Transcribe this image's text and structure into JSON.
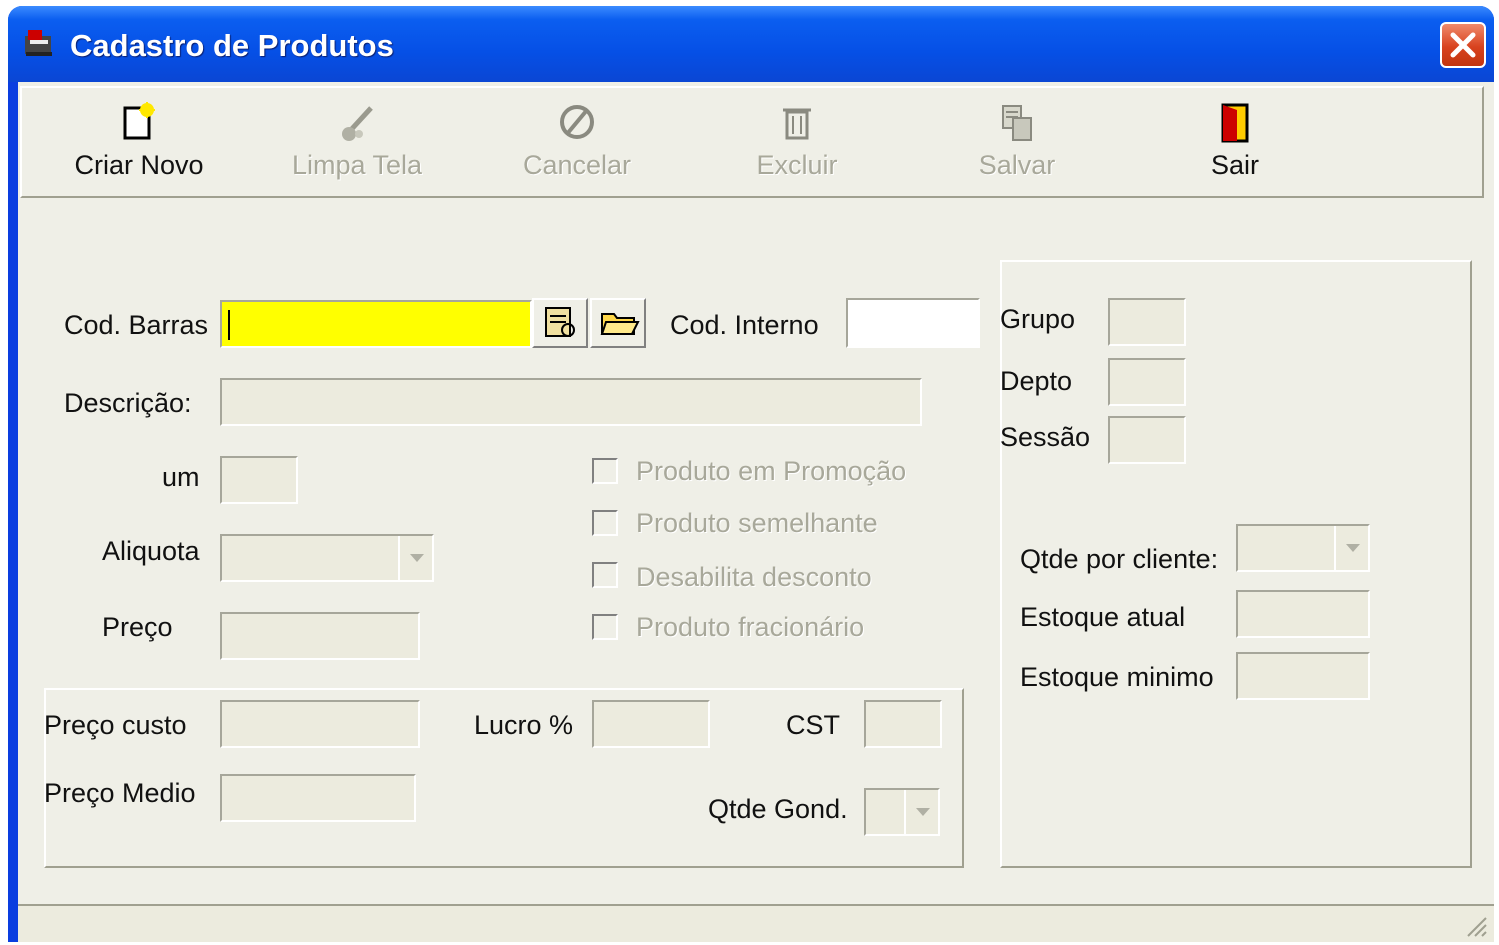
{
  "window": {
    "title": "Cadastro de Produtos"
  },
  "toolbar": {
    "criar_novo": "Criar Novo",
    "limpa_tela": "Limpa Tela",
    "cancelar": "Cancelar",
    "excluir": "Excluir",
    "salvar": "Salvar",
    "sair": "Sair"
  },
  "form": {
    "cod_barras_label": "Cod. Barras",
    "cod_barras_value": "",
    "cod_interno_label": "Cod. Interno",
    "descricao_label": "Descrição:",
    "um_label": "um",
    "aliquota_label": "Aliquota",
    "preco_label": "Preço",
    "promocao_label": "Produto em Promoção",
    "semelhante_label": "Produto semelhante",
    "desabilita_label": "Desabilita desconto",
    "fracionario_label": "Produto fracionário",
    "preco_custo_label": "Preço custo",
    "lucro_label": "Lucro %",
    "cst_label": "CST",
    "preco_medio_label": "Preço Medio",
    "qtde_gond_label": "Qtde Gond.",
    "grupo_label": "Grupo",
    "depto_label": "Depto",
    "sessao_label": "Sessão",
    "qtde_cliente_label": "Qtde por cliente:",
    "estoque_atual_label": "Estoque atual",
    "estoque_minimo_label": "Estoque minimo"
  },
  "colors": {
    "titlebar": "#0a46d4",
    "highlight_field": "#ffff00",
    "window_bg": "#efefe7"
  }
}
